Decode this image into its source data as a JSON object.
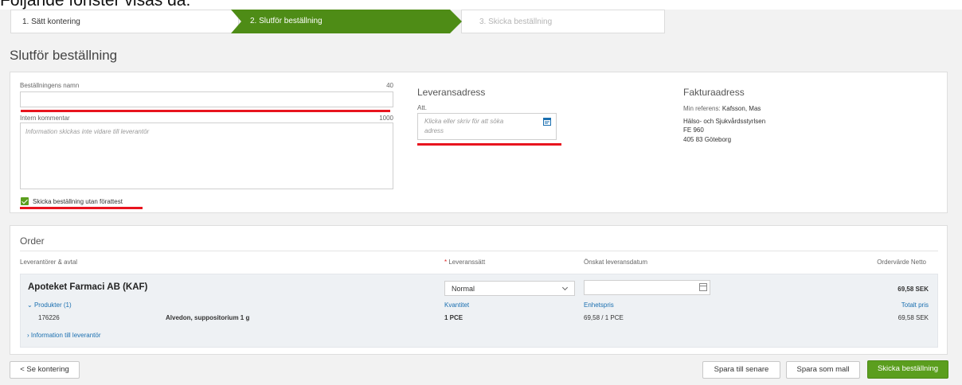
{
  "caption_cut": "Följande fönster visas då:",
  "steps": [
    {
      "label": "1. Sätt kontering"
    },
    {
      "label": "2. Slutför beställning"
    },
    {
      "label": "3. Skicka beställning"
    }
  ],
  "page_title": "Slutför beställning",
  "form": {
    "name_label": "Beställningens namn",
    "name_count": "40",
    "name_value": "",
    "comment_label": "Intern kommentar",
    "comment_count": "1000",
    "comment_placeholder": "Information skickas inte vidare till leverantör",
    "checkbox_label": "Skicka beställning utan förattest",
    "checkbox_checked": true
  },
  "delivery": {
    "title": "Leveransadress",
    "att_label": "Att.",
    "placeholder_line1": "Klicka eller skriv för att söka",
    "placeholder_line2": "adress"
  },
  "billing": {
    "title": "Fakturaadress",
    "ref_label": "Min referens:",
    "ref_value": "Kafsson, Mas",
    "line1": "Hälso- och Sjukvårdsstyrlsen",
    "line2": "FE 960",
    "line3": "405 83 Göteborg"
  },
  "order": {
    "title": "Order",
    "col_supplier": "Leverantörer & avtal",
    "col_delivery_method": "Leveranssätt",
    "col_date": "Önskat leveransdatum",
    "col_value": "Ordervärde Netto",
    "supplier": "Apoteket Farmaci AB (KAF)",
    "delivery_method": "Normal",
    "date_value": "",
    "order_value": "69,58 SEK",
    "products_toggle": "Produkter (1)",
    "qty_header": "Kvantitet",
    "unit_price_header": "Enhetspris",
    "total_header": "Totalt pris",
    "product": {
      "article": "176226",
      "name": "Alvedon, suppositorium 1 g",
      "qty": "1 PCE",
      "unit_price": "69,58 / 1 PCE",
      "total": "69,58 SEK"
    },
    "info_toggle": "Information till leverantör"
  },
  "buttons": {
    "back": "< Se kontering",
    "save_later": "Spara till senare",
    "save_template": "Spara som mall",
    "send": "Skicka beställning"
  },
  "colors": {
    "accent_green": "#5b9e1e",
    "step_active": "#4e8c16",
    "annotation_red": "#e8141e",
    "link_blue": "#1a6fb0"
  }
}
